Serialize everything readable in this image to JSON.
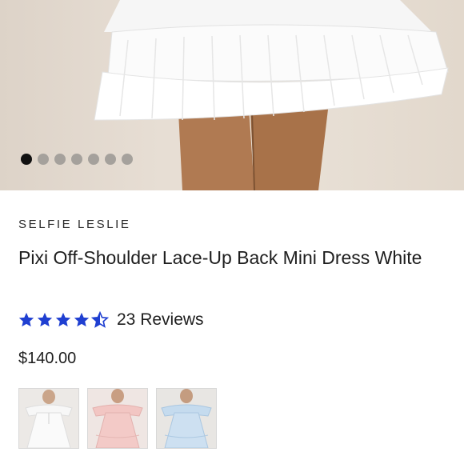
{
  "gallery": {
    "image_count": 7,
    "active_index": 0,
    "hero_alt_icon": "dress-photo"
  },
  "product": {
    "brand": "SELFIE LESLIE",
    "title": "Pixi Off-Shoulder Lace-Up Back Mini Dress White",
    "rating": 4.5,
    "reviews_label": "23 Reviews",
    "price": "$140.00"
  },
  "colors": {
    "star": "#1f3fd1",
    "active_dot": "#111111",
    "inactive_dot": "#a5a19c"
  },
  "variants": [
    {
      "name": "White",
      "swatch": "#f4f2f0"
    },
    {
      "name": "Pink",
      "swatch": "#f0c8c6"
    },
    {
      "name": "Blue",
      "swatch": "#c7dcef"
    }
  ]
}
